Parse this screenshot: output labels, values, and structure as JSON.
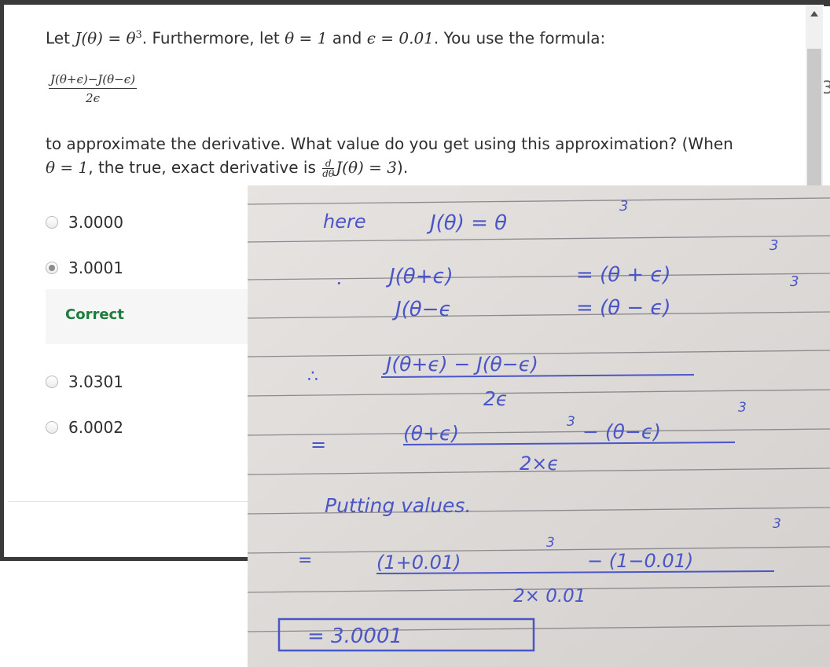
{
  "question": {
    "intro_1": "Let ",
    "J_theta": "J(θ)",
    "eq": " = ",
    "theta": "θ",
    "cube": "3",
    "intro_2": ". Furthermore, let ",
    "theta_eq_1": "θ = 1",
    "and": " and ",
    "eps_eq": "ϵ = 0.01",
    "intro_3": ". You use the formula:",
    "formula_numerator": "J(θ+ϵ)−J(θ−ϵ)",
    "formula_denominator": "2ϵ",
    "para_1": "to approximate the derivative. What value do you get using this approximation? (When",
    "para_theta": "θ = 1",
    "para_2": ", the true, exact derivative is ",
    "d_num": "d",
    "d_den": "dθ",
    "para_J": "J(θ) = 3",
    "para_3": ")."
  },
  "options": [
    {
      "label": "3.0000",
      "selected": false
    },
    {
      "label": "3.0001",
      "selected": true
    },
    {
      "label": "3.0301",
      "selected": false
    },
    {
      "label": "6.0002",
      "selected": false
    }
  ],
  "feedback": {
    "text": "Correct",
    "color": "#1d7d3b"
  },
  "background_glyphs": {
    "right_digit": "3"
  },
  "handwritten": {
    "line1_label": "here",
    "line1": "J(θ) = θ",
    "line1_exp": "3",
    "line2_lhs": "J(θ+ϵ)",
    "line2_rhs": "= (θ + ϵ)",
    "line2_exp": "3",
    "line3_lhs": "J(θ−ϵ",
    "line3_rhs": "= (θ − ϵ)",
    "line3_exp": "3",
    "line4_num": "J(θ+ϵ) − J(θ−ϵ)",
    "line4_den": "2ϵ",
    "line5_num": "(θ+ϵ)",
    "line5_exp1": "3",
    "line5_mid": "− (θ−ϵ)",
    "line5_exp2": "3",
    "line5_den": "2×ϵ",
    "line6": "Putting values.",
    "line7_num": "(1+0.01)",
    "line7_exp1": "3",
    "line7_mid": "− (1−0.01)",
    "line7_exp2": "3",
    "line7_den": "2× 0.01",
    "answer": "= 3.0001",
    "ink_color": "#4a55c8"
  }
}
